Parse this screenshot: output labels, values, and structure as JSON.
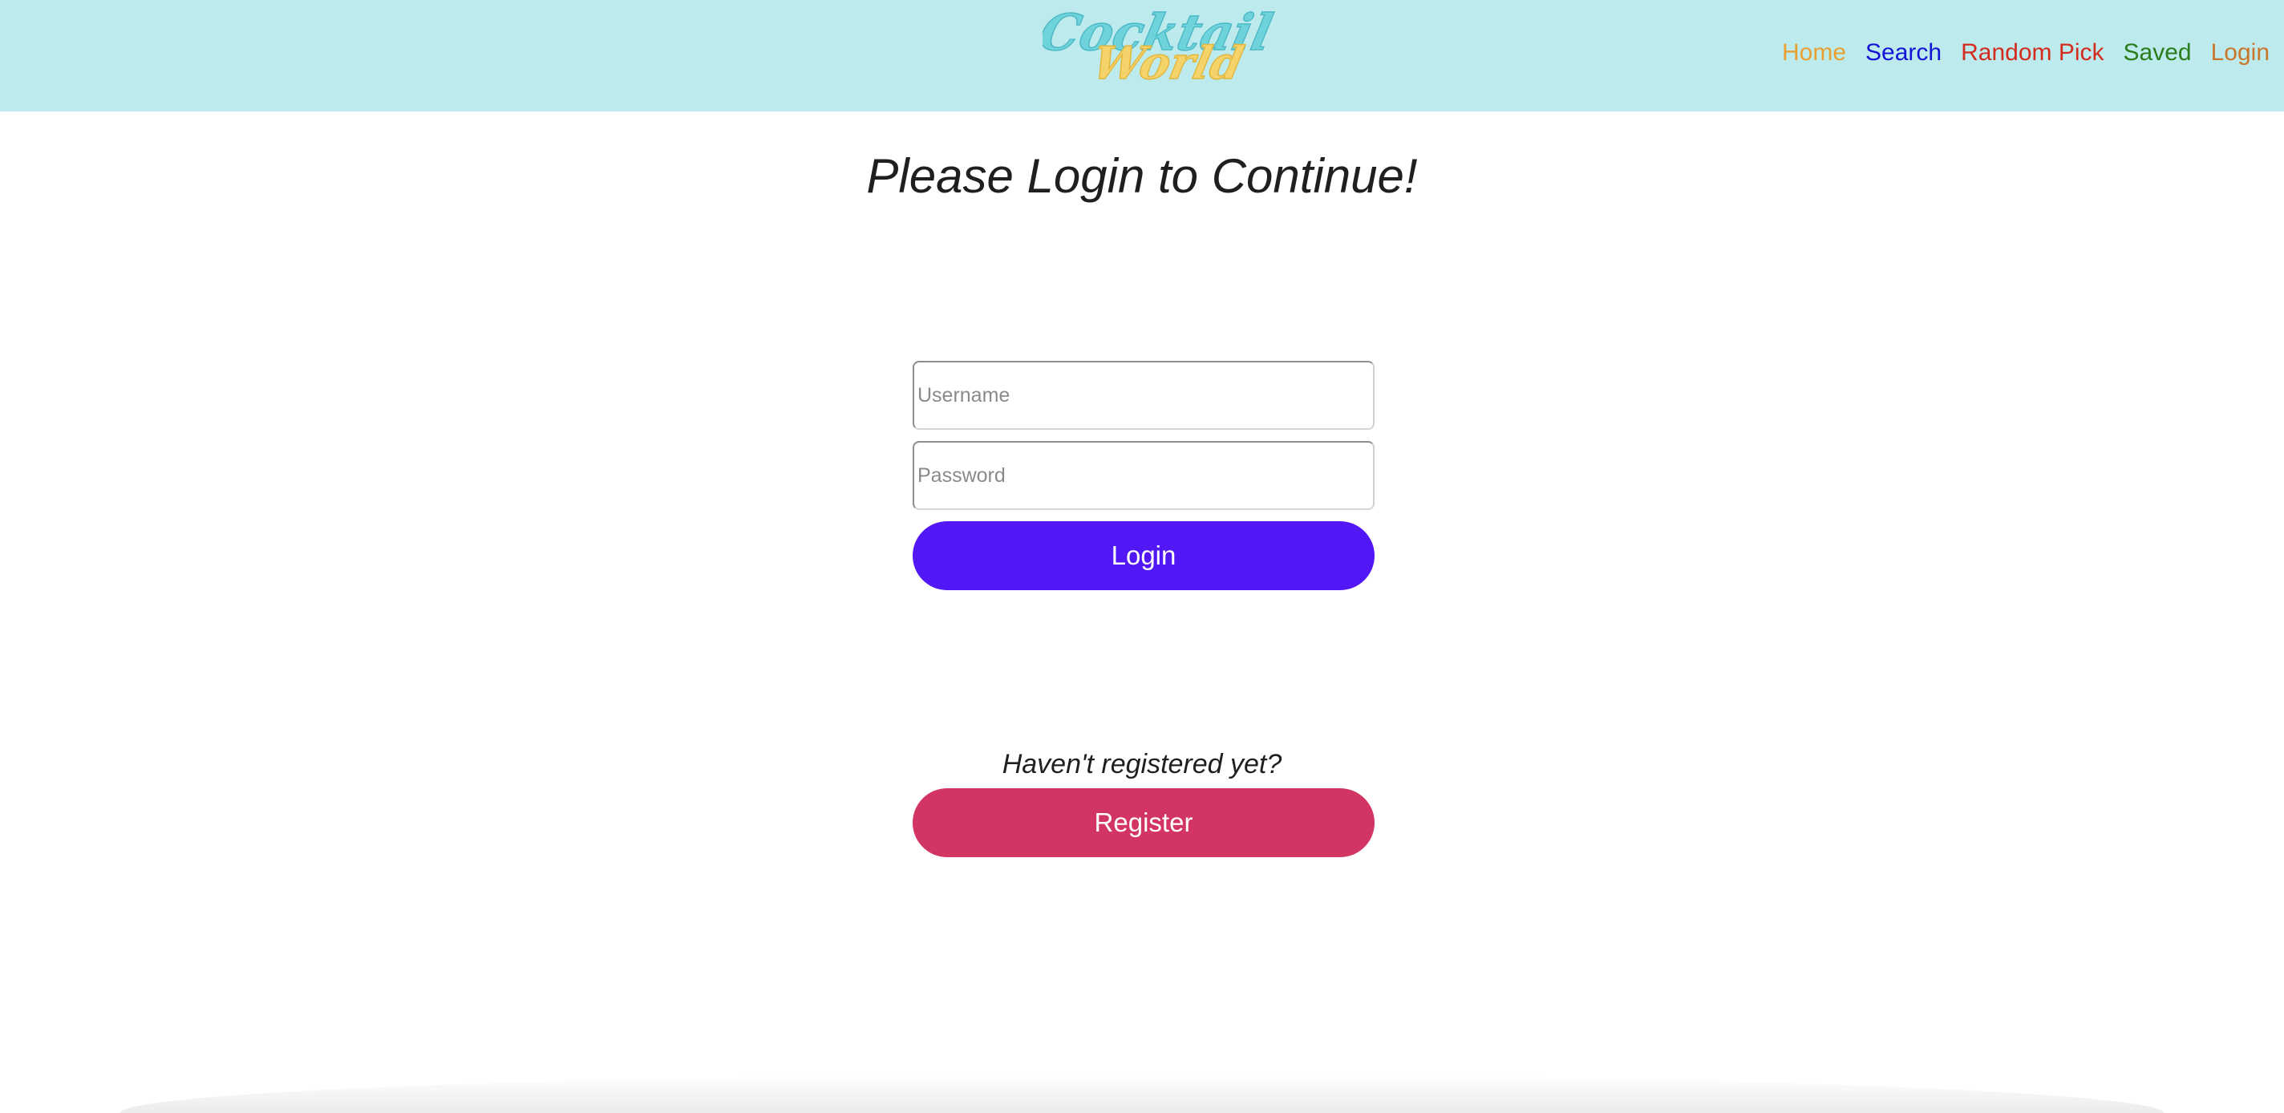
{
  "header": {
    "logo_text": "Cocktail World",
    "nav": [
      {
        "label": "Home",
        "color": "#e8a033"
      },
      {
        "label": "Search",
        "color": "#1414d6"
      },
      {
        "label": "Random Pick",
        "color": "#d42b1f"
      },
      {
        "label": "Saved",
        "color": "#2b7d1c"
      },
      {
        "label": "Login",
        "color": "#c8762b"
      }
    ],
    "background": "#bdebed"
  },
  "main": {
    "title": "Please Login to Continue!",
    "username_placeholder": "Username",
    "password_placeholder": "Password",
    "login_label": "Login",
    "login_color": "#5217f5",
    "register_prompt": "Haven't registered yet?",
    "register_label": "Register",
    "register_color": "#d23463"
  }
}
